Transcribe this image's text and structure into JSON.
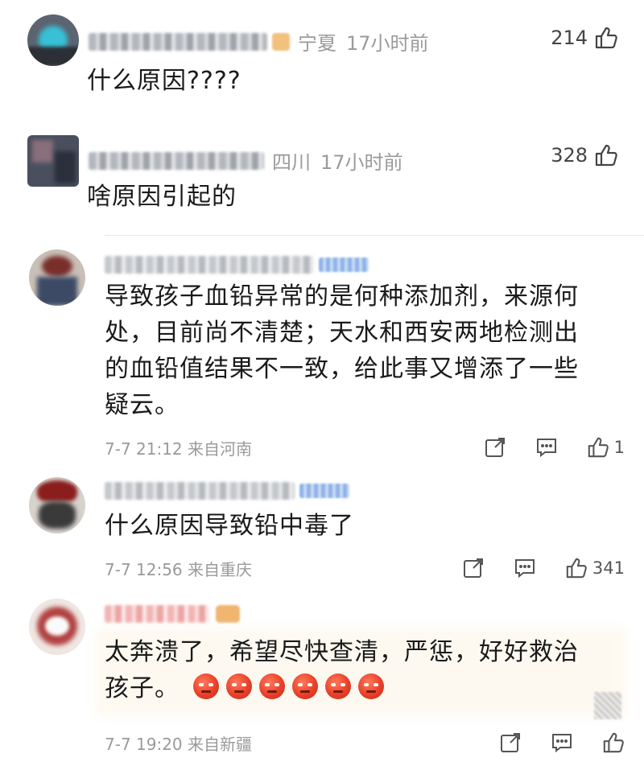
{
  "comments": [
    {
      "location": "宁夏",
      "time": "17小时前",
      "likes": "214",
      "text": "什么原因????"
    },
    {
      "location": "四川",
      "time": "17小时前",
      "likes": "328",
      "text": "啥原因引起的"
    },
    {
      "line1": "导致孩子血铅异常的是何种添加剂，来源何",
      "line2": "处，目前尚不清楚；天水和西安两地检测出",
      "line3": "的血铅值结果不一致，给此事又增添了一些",
      "line4": "疑云。",
      "footer_time": "7-7 21:12 来自河南",
      "likes": "1"
    },
    {
      "text": "什么原因导致铅中毒了",
      "footer_time": "7-7 12:56 来自重庆",
      "likes": "341"
    },
    {
      "line1": "太奔溃了，希望尽快查清，严惩，好好救治",
      "line2": "孩子。",
      "emoji_name": "angry-face-emoji",
      "emoji_count": 6,
      "footer_time": "7-7 19:20 来自新疆"
    }
  ],
  "icons": {
    "like": "thumbs-up-icon",
    "repost": "share-icon",
    "reply": "comment-icon"
  }
}
